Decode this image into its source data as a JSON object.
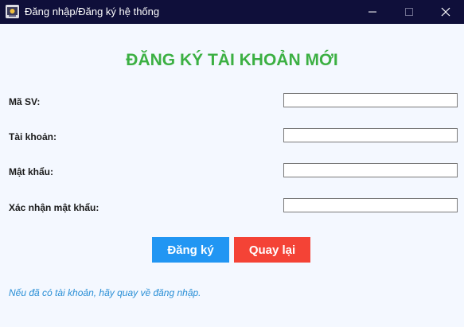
{
  "window": {
    "title": "Đăng nhập/Đăng ký hệ thống"
  },
  "form": {
    "heading": "ĐĂNG KÝ TÀI KHOẢN MỚI",
    "fields": [
      {
        "label": "Mã SV:",
        "value": ""
      },
      {
        "label": "Tài khoản:",
        "value": ""
      },
      {
        "label": "Mật khẩu:",
        "value": ""
      },
      {
        "label": "Xác nhận mật khẩu:",
        "value": ""
      }
    ],
    "register_label": "Đăng ký",
    "back_label": "Quay lại",
    "hint": "Nếu đã có tài khoản, hãy quay về đăng nhập."
  },
  "colors": {
    "title_bar": "#0f0f3a",
    "heading": "#3cb043",
    "register_button": "#2196f3",
    "back_button": "#f44336",
    "hint": "#2a8fd6",
    "background": "#f4f8ff"
  },
  "icons": {
    "app": "app-window-icon",
    "minimize": "minimize-icon",
    "maximize": "maximize-icon",
    "close": "close-icon"
  }
}
